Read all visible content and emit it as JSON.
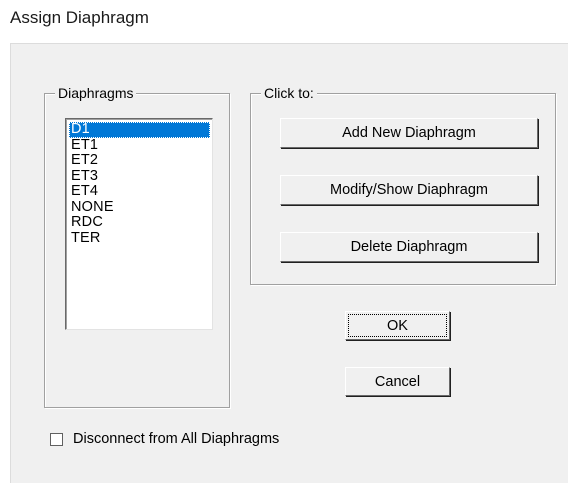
{
  "window": {
    "title": "Assign Diaphragm"
  },
  "diaphragms_group": {
    "label": "Diaphragms",
    "items": [
      "D1",
      "ET1",
      "ET2",
      "ET3",
      "ET4",
      "NONE",
      "RDC",
      "TER"
    ],
    "selected": "D1"
  },
  "click_group": {
    "label": "Click to:",
    "add_label": "Add New Diaphragm",
    "modify_label": "Modify/Show Diaphragm",
    "delete_label": "Delete Diaphragm"
  },
  "actions": {
    "ok_label": "OK",
    "cancel_label": "Cancel"
  },
  "disconnect": {
    "label": "Disconnect from All Diaphragms",
    "checked": false
  },
  "colors": {
    "selection": "#0078d7",
    "dialog_bg": "#f0f0f0"
  }
}
